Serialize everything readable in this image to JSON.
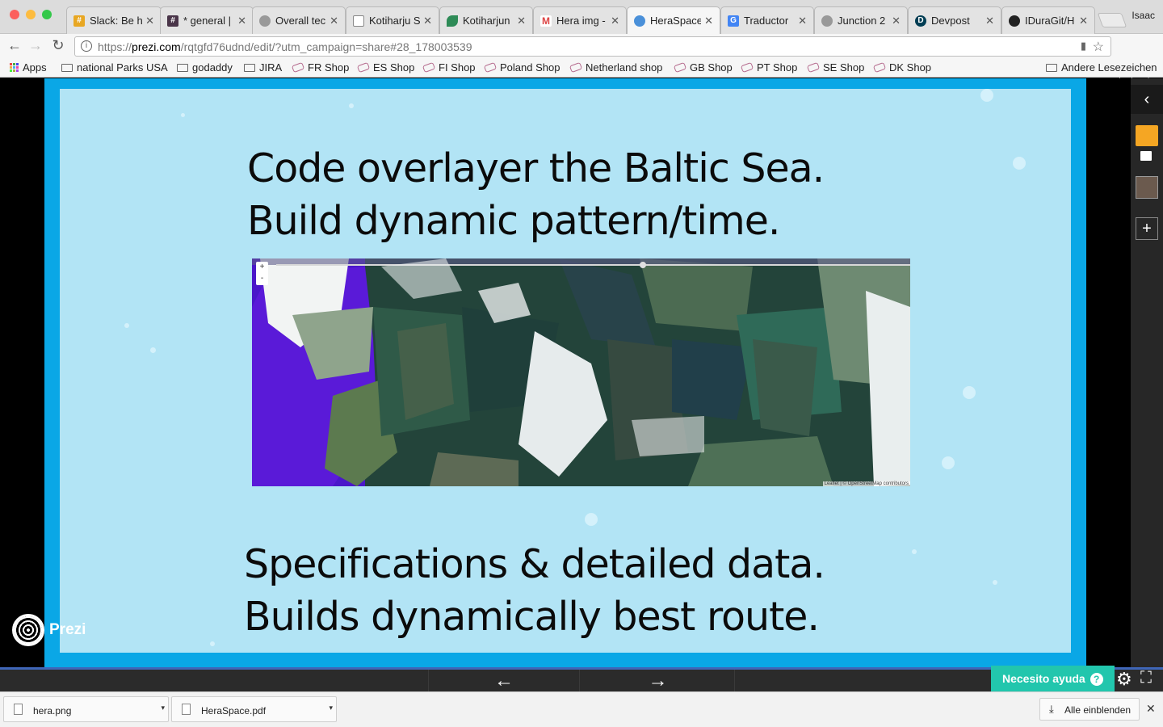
{
  "browser": {
    "profile_name": "Isaac",
    "tabs": [
      {
        "title": "Slack: Be h",
        "active": false
      },
      {
        "title": "* general |",
        "active": false
      },
      {
        "title": "Overall tec",
        "active": false
      },
      {
        "title": "Kotiharju S",
        "active": false
      },
      {
        "title": "Kotiharjun",
        "active": false
      },
      {
        "title": "Hera img -",
        "active": false
      },
      {
        "title": "HeraSpace",
        "active": true
      },
      {
        "title": "Traductor",
        "active": false
      },
      {
        "title": "Junction 2",
        "active": false
      },
      {
        "title": "Devpost",
        "active": false
      },
      {
        "title": "IDuraGit/H",
        "active": false
      }
    ],
    "url_scheme": "https://",
    "url_host": "prezi.com",
    "url_path": "/rqtgfd76udnd/edit/?utm_campaign=share#28_178003539",
    "bookmarks": [
      {
        "label": "Apps",
        "icon": "apps-grid-icon"
      },
      {
        "label": "national Parks USA",
        "icon": "folder-icon"
      },
      {
        "label": "godaddy",
        "icon": "folder-icon"
      },
      {
        "label": "JIRA",
        "icon": "folder-icon"
      },
      {
        "label": "FR Shop",
        "icon": "tag-icon"
      },
      {
        "label": "ES Shop",
        "icon": "tag-icon"
      },
      {
        "label": "FI Shop",
        "icon": "tag-icon"
      },
      {
        "label": "Poland Shop",
        "icon": "tag-icon"
      },
      {
        "label": "Netherland shop",
        "icon": "tag-icon"
      },
      {
        "label": "GB Shop",
        "icon": "tag-icon"
      },
      {
        "label": "PT Shop",
        "icon": "tag-icon"
      },
      {
        "label": "SE Shop",
        "icon": "tag-icon"
      },
      {
        "label": "DK Shop",
        "icon": "tag-icon"
      }
    ],
    "other_bookmarks": "Andere Lesezeichen"
  },
  "slide": {
    "heading_top_line1": "Code overlayer the Baltic Sea.",
    "heading_top_line2": "Build dynamic pattern/time.",
    "heading_bottom_line1": "Specifications & detailed data.",
    "heading_bottom_line2": "Builds dynamically best route.",
    "map_zoom_in": "+",
    "map_zoom_out": "-",
    "map_attribution": "Leaflet | © OpenStreetMap contributors"
  },
  "prezi": {
    "logo_text": "Prezi",
    "help_label": "Necesito ayuda",
    "help_q": "?",
    "prev_arrow": "←",
    "next_arrow": "→"
  },
  "downloads": {
    "files": [
      "hera.png",
      "HeraSpace.pdf"
    ],
    "show_all": "Alle einblenden"
  }
}
